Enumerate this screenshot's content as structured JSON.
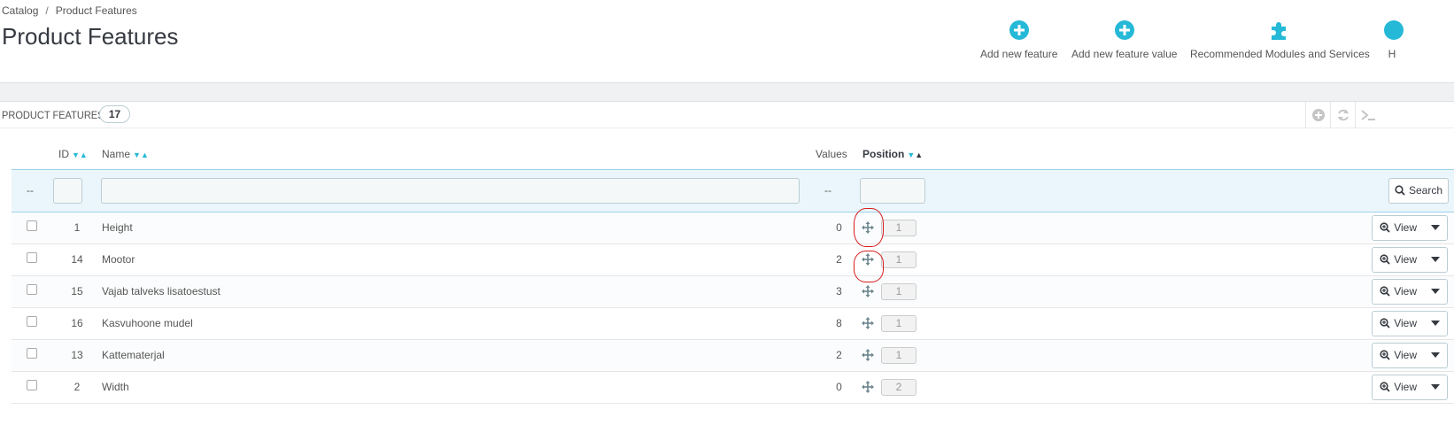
{
  "breadcrumb": {
    "parent": "Catalog",
    "separator": "/",
    "current": "Product Features"
  },
  "page_title": "Product Features",
  "toolbar": {
    "add_feature": "Add new feature",
    "add_feature_value": "Add new feature value",
    "recommended": "Recommended Modules and Services",
    "help": "H"
  },
  "panel": {
    "title": "PRODUCT FEATURES",
    "count": "17"
  },
  "table": {
    "headers": {
      "id": "ID",
      "name": "Name",
      "values": "Values",
      "position": "Position"
    },
    "filter": {
      "checkbox_placeholder": "--",
      "values_placeholder": "--",
      "search_label": "Search"
    },
    "view_label": "View",
    "rows": [
      {
        "id": "1",
        "name": "Height",
        "values": "0",
        "position": "1"
      },
      {
        "id": "14",
        "name": "Mootor",
        "values": "2",
        "position": "1"
      },
      {
        "id": "15",
        "name": "Vajab talveks lisatoestust",
        "values": "3",
        "position": "1"
      },
      {
        "id": "16",
        "name": "Kasvuhoone mudel",
        "values": "8",
        "position": "1"
      },
      {
        "id": "13",
        "name": "Kattematerjal",
        "values": "2",
        "position": "1"
      },
      {
        "id": "2",
        "name": "Width",
        "values": "0",
        "position": "2"
      }
    ]
  },
  "colors": {
    "accent": "#25b9d7",
    "filter_bg": "#eaf6fb",
    "annotation": "#d81e1e"
  }
}
